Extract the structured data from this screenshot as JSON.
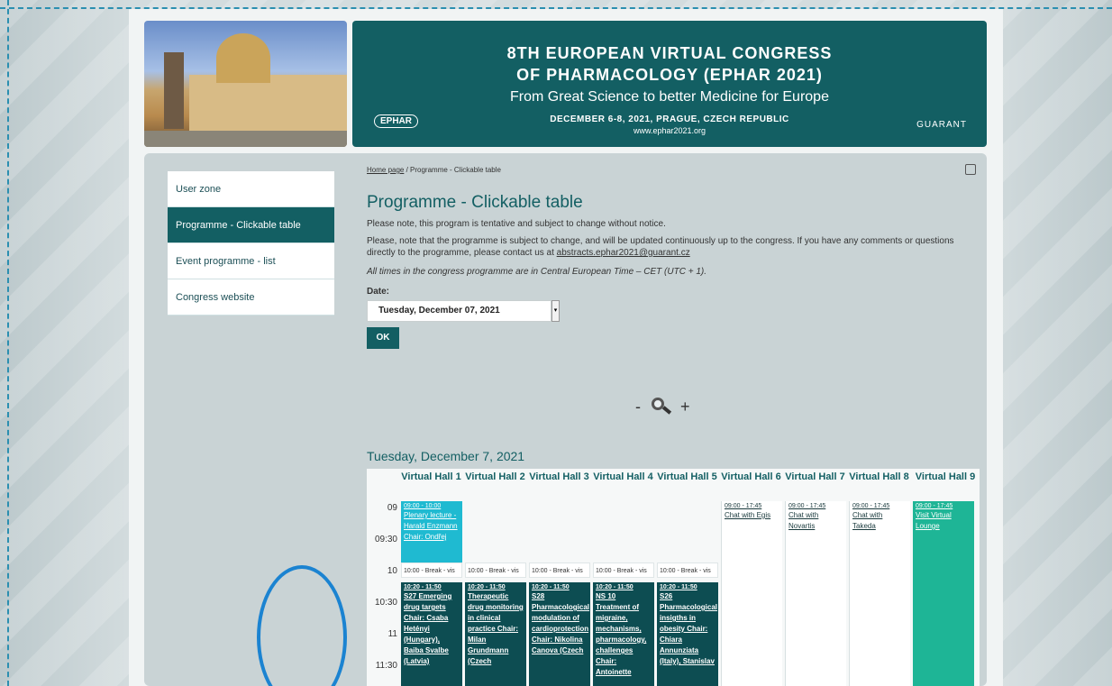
{
  "banner": {
    "line1": "8TH EUROPEAN VIRTUAL CONGRESS",
    "line2": "OF PHARMACOLOGY (EPHAR 2021)",
    "tagline": "From Great Science to better Medicine for Europe",
    "dates": "DECEMBER 6-8, 2021, PRAGUE, CZECH REPUBLIC",
    "url": "www.ephar2021.org",
    "left_logo": "EPHAR",
    "right_logo": "GUARANT"
  },
  "sidebar": {
    "items": [
      {
        "label": "User zone"
      },
      {
        "label": "Programme - Clickable table"
      },
      {
        "label": "Event programme - list"
      },
      {
        "label": "Congress website"
      }
    ]
  },
  "breadcrumb": {
    "home": "Home page",
    "sep": " / ",
    "current": "Programme - Clickable table"
  },
  "page": {
    "title": "Programme - Clickable table",
    "note1": "Please note, this program is tentative and subject to change without notice.",
    "note2": "Please, note that the programme is subject to change, and will be updated continuously up to the congress. If you have any comments or questions directly to the programme, please contact us at ",
    "email": "abstracts.ephar2021@guarant.cz",
    "note3": "All times in the congress programme are in Central European Time – CET (UTC + 1).",
    "date_label": "Date:",
    "date_value": "Tuesday, December 07, 2021",
    "ok_label": "OK",
    "zoom_minus": "-",
    "zoom_plus": "+",
    "day_title": "Tuesday, December 7, 2021"
  },
  "programme": {
    "halls": [
      "Virtual Hall 1",
      "Virtual Hall 2",
      "Virtual Hall 3",
      "Virtual Hall 4",
      "Virtual Hall 5",
      "Virtual Hall 6",
      "Virtual Hall 7",
      "Virtual Hall 8",
      "Virtual Hall 9"
    ],
    "times": [
      "09",
      "09:30",
      "10",
      "10:30",
      "11",
      "11:30"
    ],
    "plenary": {
      "time": "09:00 - 10:00",
      "text": "Plenary lecture - Harald Enzmann Chair: Ondřej"
    },
    "break_label": "10:00 - Break - vis",
    "sessions": [
      {
        "time": "10:20 - 11:50",
        "text": "S27 Emerging drug targets Chair: Csaba Hetényi (Hungary), Baiba Svalbe (Latvia)"
      },
      {
        "time": "10:20 - 11:50",
        "text": "Therapeutic drug monitoring in clinical practice Chair: Milan Grundmann (Czech"
      },
      {
        "time": "10:20 - 11:50",
        "text": "S28 Pharmacological modulation of cardioprotection Chair: Nikolina Canova (Czech"
      },
      {
        "time": "10:20 - 11:50",
        "text": "NS 10 Treatment of migraine, mechanisms, pharmacology, challenges Chair: Antoinette"
      },
      {
        "time": "10:20 - 11:50",
        "text": "S26 Pharmacological insigths in obesity Chair: Chiara Annunziata (Italy), Stanislav"
      }
    ],
    "chats": [
      {
        "time": "09:00 - 17:45",
        "text": "Chat with Egis"
      },
      {
        "time": "09:00 - 17:45",
        "text": "Chat with Novartis"
      },
      {
        "time": "09:00 - 17:45",
        "text": "Chat with Takeda"
      }
    ],
    "lounge": {
      "time": "09:00 - 17:45",
      "text": "Visit Virtual Lounge"
    }
  }
}
